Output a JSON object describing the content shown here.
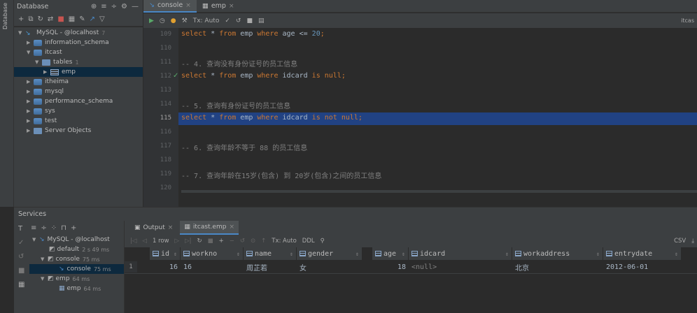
{
  "sidebar": {
    "vertical_label": "Database",
    "header_title": "Database",
    "tree": [
      {
        "label": "MySQL - @localhost",
        "badge": "7"
      },
      {
        "label": "information_schema"
      },
      {
        "label": "itcast"
      },
      {
        "label": "tables",
        "badge": "1"
      },
      {
        "label": "emp"
      },
      {
        "label": "itheima"
      },
      {
        "label": "mysql"
      },
      {
        "label": "performance_schema"
      },
      {
        "label": "sys"
      },
      {
        "label": "test"
      },
      {
        "label": "Server Objects"
      }
    ]
  },
  "editor": {
    "tabs": [
      {
        "label": "console"
      },
      {
        "label": "emp"
      }
    ],
    "tx_label": "Tx: Auto",
    "right_label": "itcas",
    "lines": [
      {
        "num": "109"
      },
      {
        "num": "110"
      },
      {
        "num": "111"
      },
      {
        "num": "112"
      },
      {
        "num": "113"
      },
      {
        "num": "114"
      },
      {
        "num": "115"
      },
      {
        "num": "116"
      },
      {
        "num": "117"
      },
      {
        "num": "118"
      },
      {
        "num": "119"
      },
      {
        "num": "120"
      }
    ],
    "code": {
      "l109": {
        "a": "select",
        "b": " * ",
        "c": "from",
        "d": " emp ",
        "e": "where",
        "f": " age <= ",
        "g": "20",
        "h": ";"
      },
      "l111": "-- 4. 查询没有身份证号的员工信息",
      "l112": {
        "a": "select",
        "b": " * ",
        "c": "from",
        "d": " emp ",
        "e": "where",
        "f": " idcard ",
        "g": "is null",
        "h": ";"
      },
      "l114": "-- 5. 查询有身份证号的员工信息",
      "l115": {
        "a": "select",
        "b": " * ",
        "c": "from",
        "d": " emp ",
        "e": "where",
        "f": " idcard ",
        "g": "is not null",
        "h": ";"
      },
      "l117": "-- 6. 查询年龄不等于 88 的员工信息",
      "l119": "-- 7. 查询年龄在15岁(包含) 到 20岁(包含)之间的员工信息"
    }
  },
  "services": {
    "title": "Services",
    "tree": [
      {
        "label": "MySQL - @localhost",
        "time": ""
      },
      {
        "label": "default",
        "time": "2 s 49 ms"
      },
      {
        "label": "console",
        "time": "75 ms"
      },
      {
        "label": "console",
        "time": "75 ms"
      },
      {
        "label": "emp",
        "time": "64 ms"
      },
      {
        "label": "emp",
        "time": "64 ms"
      }
    ],
    "tabs": [
      {
        "label": "Output"
      },
      {
        "label": "itcast.emp"
      }
    ],
    "toolbar": {
      "rows": "1 row",
      "tx": "Tx: Auto",
      "ddl": "DDL",
      "csv": "CSV"
    },
    "columns": [
      "id",
      "workno",
      "name",
      "gender",
      "age",
      "idcard",
      "workaddress",
      "entrydate"
    ],
    "rows": [
      {
        "rownum": "1",
        "id": "16",
        "workno": "16",
        "name": "周芷若",
        "gender": "女",
        "age": "18",
        "idcard": "<null>",
        "workaddress": "北京",
        "entrydate": "2012-06-01"
      }
    ]
  }
}
